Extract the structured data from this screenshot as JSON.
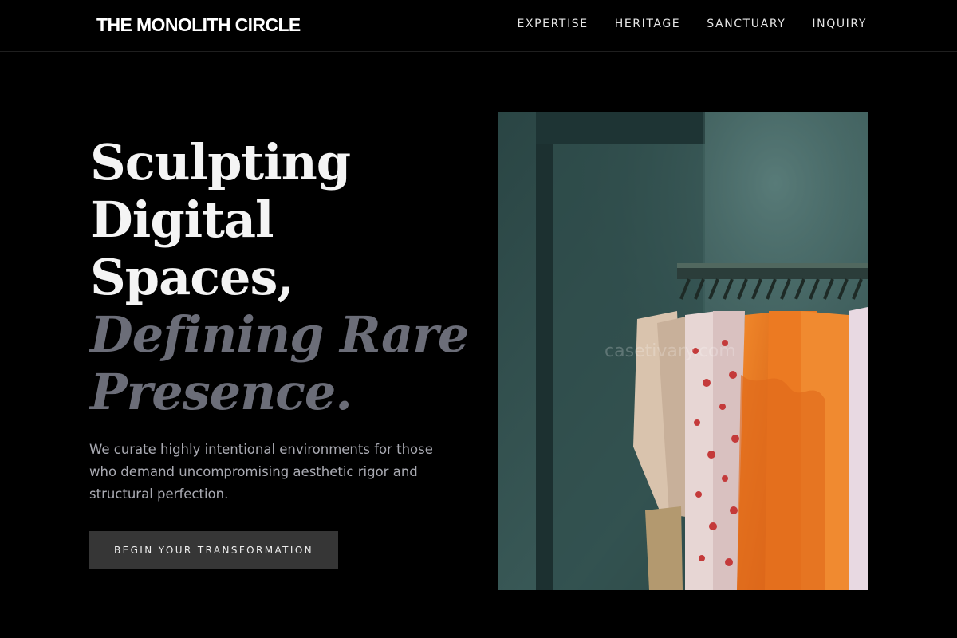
{
  "header": {
    "brand": "THE MONOLITH CIRCLE",
    "nav": [
      "EXPERTISE",
      "HERITAGE",
      "SANCTUARY",
      "INQUIRY"
    ]
  },
  "hero": {
    "heading_lines": [
      "Sculpting",
      "Digital",
      "Spaces,"
    ],
    "accent_lines": [
      "Defining Rare",
      "Presence."
    ],
    "subtitle": "We curate highly intentional environments for those who demand uncompromising aesthetic rigor and structural perfection.",
    "cta_label": "BEGIN YOUR TRANSFORMATION",
    "image": {
      "description_icon": "clothing-rack-photo",
      "watermark": "casetivary.com"
    }
  },
  "colors": {
    "background": "#000000",
    "heading": "#f4f4f4",
    "heading_accent": "#6b6d78",
    "body_text": "#a9aab2",
    "button_bg": "#363636"
  }
}
